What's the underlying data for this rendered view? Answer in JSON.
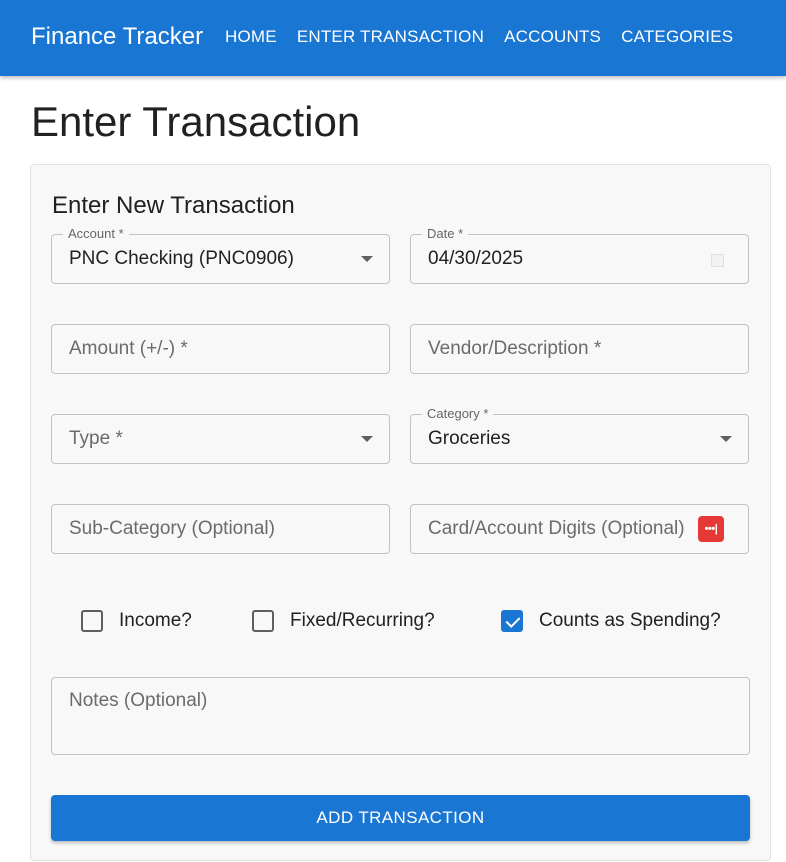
{
  "app": {
    "title": "Finance Tracker"
  },
  "nav": {
    "items": [
      {
        "label": "HOME"
      },
      {
        "label": "ENTER TRANSACTION"
      },
      {
        "label": "ACCOUNTS"
      },
      {
        "label": "CATEGORIES"
      }
    ]
  },
  "page": {
    "title": "Enter Transaction"
  },
  "form": {
    "title": "Enter New Transaction",
    "account": {
      "label": "Account *",
      "value": "PNC Checking (PNC0906)"
    },
    "date": {
      "label": "Date *",
      "value": "04/30/2025"
    },
    "amount": {
      "placeholder": "Amount (+/-) *",
      "value": ""
    },
    "vendor": {
      "placeholder": "Vendor/Description *",
      "value": ""
    },
    "type": {
      "placeholder": "Type *",
      "value": ""
    },
    "category": {
      "label": "Category *",
      "value": "Groceries"
    },
    "subcategory": {
      "placeholder": "Sub-Category (Optional)",
      "value": ""
    },
    "card_digits": {
      "placeholder": "Card/Account Digits (Optional)",
      "value": "",
      "icon": "password-manager-icon",
      "icon_glyph": "•••|"
    },
    "checkboxes": [
      {
        "label": "Income?",
        "checked": false
      },
      {
        "label": "Fixed/Recurring?",
        "checked": false
      },
      {
        "label": "Counts as Spending?",
        "checked": true
      }
    ],
    "notes": {
      "placeholder": "Notes (Optional)",
      "value": ""
    },
    "submit_label": "ADD TRANSACTION"
  },
  "colors": {
    "primary": "#1976d2",
    "accent_red": "#e53935"
  }
}
